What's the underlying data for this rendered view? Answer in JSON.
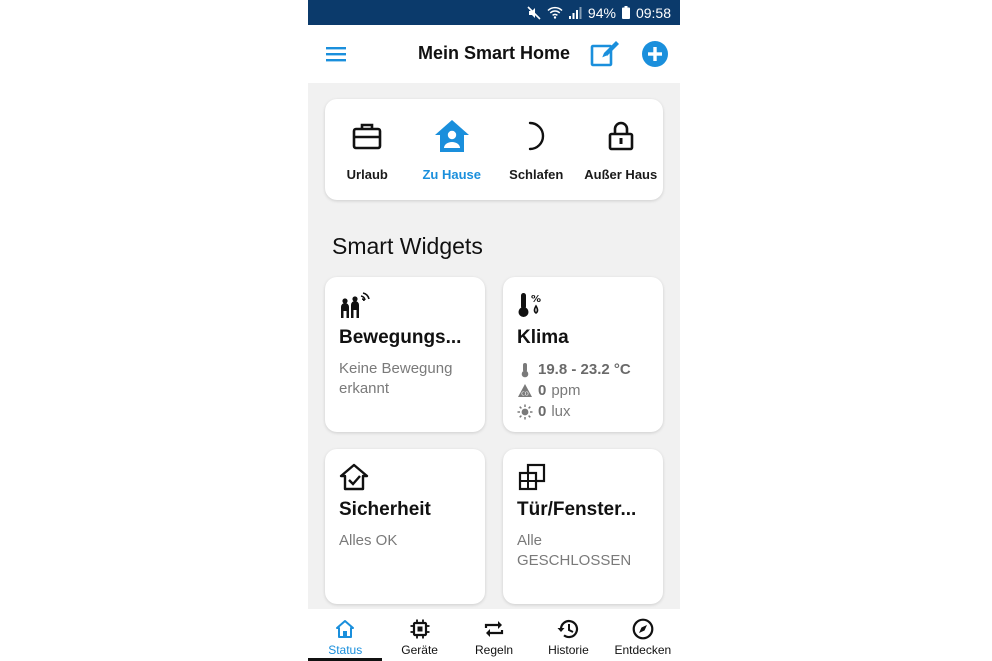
{
  "statusbar": {
    "battery": "94%",
    "time": "09:58"
  },
  "header": {
    "title": "Mein Smart Home"
  },
  "modes": [
    {
      "label": "Urlaub",
      "icon": "briefcase-icon",
      "active": false
    },
    {
      "label": "Zu Hause",
      "icon": "home-person-icon",
      "active": true
    },
    {
      "label": "Schlafen",
      "icon": "moon-icon",
      "active": false
    },
    {
      "label": "Außer Haus",
      "icon": "lock-icon",
      "active": false
    }
  ],
  "widgets_title": "Smart Widgets",
  "widgets": {
    "motion": {
      "title": "Bewegungs...",
      "subtitle": "Keine Bewegung erkannt",
      "icon": "motion-people-icon"
    },
    "climate": {
      "title": "Klima",
      "temperature": "19.8 - 23.2 °C",
      "co2_value": "0",
      "co2_unit": "ppm",
      "light_value": "0",
      "light_unit": "lux",
      "icon": "thermometer-humidity-icon"
    },
    "security": {
      "title": "Sicherheit",
      "subtitle": "Alles OK",
      "icon": "house-check-icon"
    },
    "doors": {
      "title": "Tür/Fenster...",
      "subtitle": "Alle GESCHLOSSEN",
      "icon": "window-icon"
    }
  },
  "nav": [
    {
      "label": "Status",
      "icon": "home-icon",
      "active": true
    },
    {
      "label": "Geräte",
      "icon": "chip-icon",
      "active": false
    },
    {
      "label": "Regeln",
      "icon": "repeat-icon",
      "active": false
    },
    {
      "label": "Historie",
      "icon": "history-icon",
      "active": false
    },
    {
      "label": "Entdecken",
      "icon": "compass-icon",
      "active": false
    }
  ],
  "colors": {
    "accent": "#1a8fdc",
    "statusbar": "#0b3a6b",
    "background": "#f1f1f1"
  }
}
